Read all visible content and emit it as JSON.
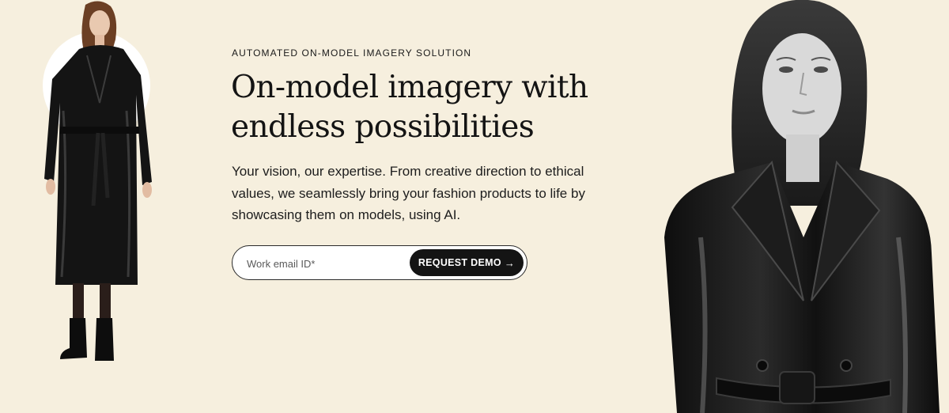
{
  "hero": {
    "eyebrow": "AUTOMATED ON-MODEL IMAGERY SOLUTION",
    "headline_line1": "On-model imagery with",
    "headline_line2": "endless possibilities",
    "subtext": "Your vision, our expertise. From creative direction to ethical values, we seamlessly bring your fashion products to life by showcasing them on models, using AI."
  },
  "form": {
    "email_placeholder": "Work email ID*",
    "button_label": "REQUEST DEMO",
    "button_icon": "arrow-right-icon",
    "button_arrow": "→"
  },
  "colors": {
    "background": "#f6efde",
    "button_bg": "#141414",
    "button_text": "#ffffff",
    "text": "#141414"
  },
  "images": {
    "left": "full-length model in long black leather trench coat with belt, black tights and ankle boots",
    "right": "close-up monochrome portrait of model in black leather trench coat"
  }
}
